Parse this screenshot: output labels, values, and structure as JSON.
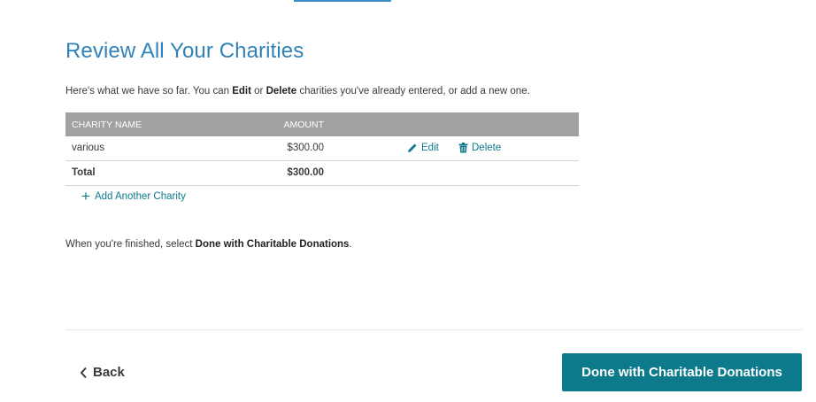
{
  "page": {
    "title": "Review All Your Charities",
    "intro_prefix": "Here's what we have so far. You can ",
    "intro_edit": "Edit",
    "intro_or": " or ",
    "intro_delete": "Delete",
    "intro_suffix": " charities you've already entered, or add a new one."
  },
  "table": {
    "columns": [
      "CHARITY NAME",
      "AMOUNT"
    ],
    "rows": [
      {
        "name": "various",
        "amount": "$300.00",
        "edit_label": "Edit",
        "delete_label": "Delete"
      }
    ],
    "total_label": "Total",
    "total_amount": "$300.00"
  },
  "add_link": "Add Another Charity",
  "finish": {
    "prefix": "When you're finished, select ",
    "bold": "Done with Charitable Donations",
    "suffix": "."
  },
  "footer": {
    "back_label": "Back",
    "done_label": "Done with Charitable Donations"
  },
  "colors": {
    "title": "#2f81b7",
    "accent": "#0d7a8c",
    "table_header": "#a1a1a1"
  },
  "icons": [
    "pencil-icon",
    "trash-icon",
    "plus-icon",
    "chevron-left-icon"
  ]
}
